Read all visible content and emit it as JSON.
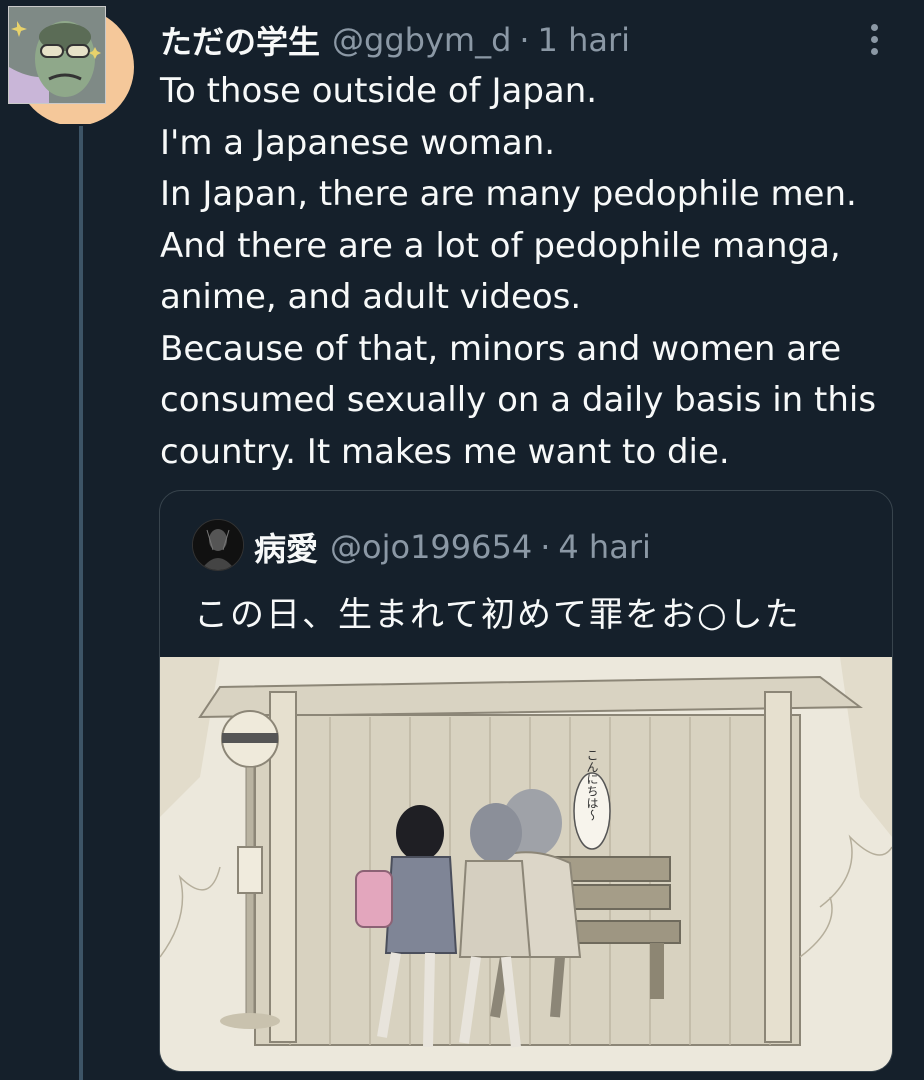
{
  "tweet": {
    "display_name": "ただの学生",
    "handle": "@ggbym_d",
    "separator": "·",
    "time": "1 hari",
    "lines": [
      "To those outside of Japan.",
      "I'm a Japanese woman.",
      "In Japan, there are many pedophile men.",
      "And there are a lot of pedophile manga,",
      "anime, and adult videos.",
      "Because of that, minors and women are",
      "consumed sexually on a daily basis in this",
      "country. It makes me want to die."
    ]
  },
  "quoted": {
    "display_name": "病愛",
    "handle": "@ojo199654",
    "separator": "·",
    "time": "4 hari",
    "text": "この日、生まれて初めて罪をお○した",
    "image_speech": "こんにちは〜"
  },
  "colors": {
    "background": "#15202b",
    "text_primary": "#f7f9f9",
    "text_secondary": "#8b98a5",
    "border": "#38444d"
  },
  "icons": {
    "more": "more-vertical-icon"
  }
}
